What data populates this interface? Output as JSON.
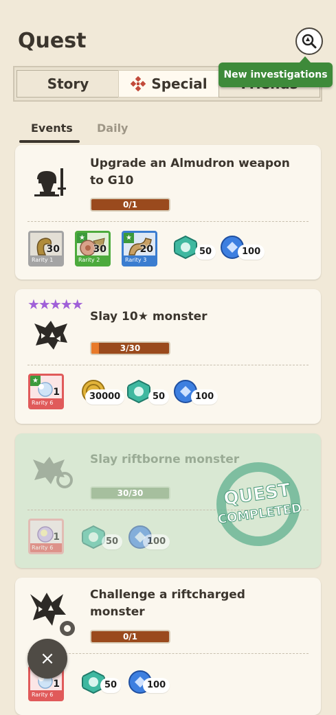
{
  "header": {
    "title": "Quest",
    "search_icon": "investigate-search-icon",
    "tooltip": "New investigations"
  },
  "tabs": [
    {
      "label": "Story"
    },
    {
      "label": "Special",
      "icon": "special-diamond-icon"
    },
    {
      "label": "Friends"
    }
  ],
  "sub_tabs": [
    {
      "label": "Events"
    },
    {
      "label": "Daily"
    }
  ],
  "quests": [
    {
      "name_line1": "Upgrade an Almudron weapon",
      "name_line2": "to G10",
      "progress": "0/1",
      "progress_value": 0,
      "rewards": [
        {
          "kind": "material-tile",
          "icon": "horn-material-icon",
          "count": "30",
          "rarity": "Rarity 1",
          "color": "#a4a4a4"
        },
        {
          "kind": "material-tile",
          "icon": "shield-material-icon",
          "count": "30",
          "rarity": "Rarity 2",
          "color": "#4caa3c",
          "new": true
        },
        {
          "kind": "material-tile",
          "icon": "hook-material-icon",
          "count": "20",
          "rarity": "Rarity 3",
          "color": "#3a7dd0",
          "new": true
        },
        {
          "kind": "gem",
          "icon": "green-gem-icon",
          "count": "50"
        },
        {
          "kind": "orb",
          "icon": "blue-orb-icon",
          "count": "100"
        }
      ]
    },
    {
      "stars": "★★★★★",
      "name_line1": "Slay 10★ monster",
      "progress": "3/30",
      "progress_value": 0.1,
      "rewards": [
        {
          "kind": "material-tile",
          "icon": "frost-material-icon",
          "count": "1",
          "rarity": "Rarity 6",
          "color": "#e05a5a",
          "new": true
        },
        {
          "kind": "coin",
          "icon": "gold-coin-icon",
          "count": "30000"
        },
        {
          "kind": "gem",
          "icon": "green-gem-icon",
          "count": "50"
        },
        {
          "kind": "orb",
          "icon": "blue-orb-icon",
          "count": "100"
        }
      ]
    },
    {
      "name_line1": "Slay riftborne monster",
      "progress": "30/30",
      "progress_value": 1,
      "completed": true,
      "stamp": [
        "QUEST",
        "COMPLETED"
      ],
      "rewards": [
        {
          "kind": "material-tile",
          "icon": "rift-material-icon",
          "count": "1",
          "rarity": "Rarity 6",
          "color": "#e05a5a"
        },
        {
          "kind": "gem",
          "icon": "green-gem-icon",
          "count": "50"
        },
        {
          "kind": "orb",
          "icon": "blue-orb-icon",
          "count": "100"
        }
      ]
    },
    {
      "name_line1": "Challenge a riftcharged",
      "name_line2": "monster",
      "progress": "0/1",
      "progress_value": 0,
      "rewards": [
        {
          "kind": "material-tile",
          "icon": "frost-material-icon",
          "count": "1",
          "rarity": "Rarity 6",
          "color": "#e05a5a"
        },
        {
          "kind": "gem",
          "icon": "green-gem-icon",
          "count": "50"
        },
        {
          "kind": "orb",
          "icon": "blue-orb-icon",
          "count": "100"
        }
      ]
    }
  ],
  "fab": {
    "icon": "close-icon",
    "label": "×"
  },
  "colors": {
    "background": "#f1e9d8",
    "accent_green": "#3e8a3a",
    "progress_brown": "#9a4a1d",
    "progress_orange": "#e87a2a"
  }
}
